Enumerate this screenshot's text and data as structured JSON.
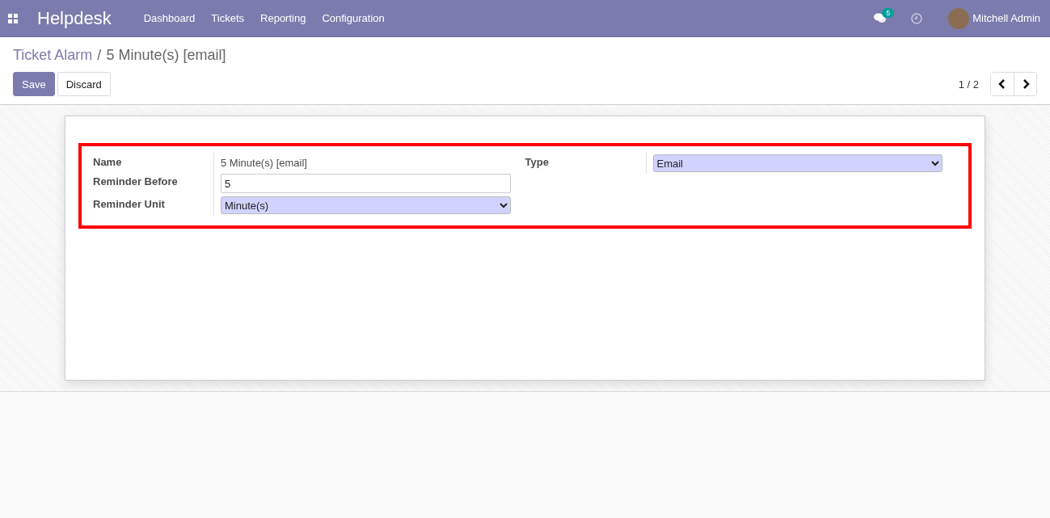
{
  "navbar": {
    "app_name": "Helpdesk",
    "menu": [
      "Dashboard",
      "Tickets",
      "Reporting",
      "Configuration"
    ],
    "messages_count": "5",
    "user": "Mitchell Admin"
  },
  "breadcrumb": {
    "parent": "Ticket Alarm",
    "separator": "/",
    "current": "5 Minute(s) [email]"
  },
  "buttons": [
    {
      "label": "Save",
      "kind": "primary"
    },
    {
      "label": "Discard",
      "kind": "secondary"
    }
  ],
  "pager": {
    "value": "1 / 2"
  },
  "form": {
    "highlighted": true,
    "left_fields": [
      {
        "label": "Name",
        "kind": "text",
        "value": "5 Minute(s) [email]"
      },
      {
        "label": "Reminder Before",
        "kind": "input",
        "value": "5"
      },
      {
        "label": "Reminder Unit",
        "kind": "select",
        "value": "Minute(s)"
      }
    ],
    "right_fields": [
      {
        "label": "Type",
        "kind": "select",
        "value": "Email"
      }
    ]
  }
}
